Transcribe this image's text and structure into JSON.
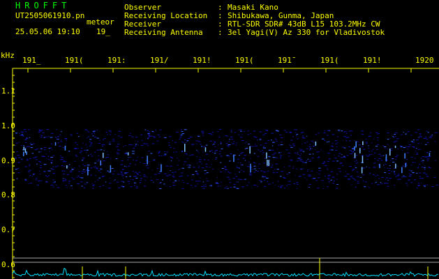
{
  "header": {
    "logo": "HROFFT",
    "filename": "UT2505061910.pn",
    "meteor_label": "meteor",
    "date_time": "25.05.06 19:10",
    "minute_label": "19_",
    "fields": [
      {
        "label": "Observer",
        "value": "Masaki Kano"
      },
      {
        "label": "Receiving Location",
        "value": "Shibukawa, Gunma, Japan"
      },
      {
        "label": "Receiver",
        "value": "RTL-SDR SDR# 43dB L15 103.2MHz CW"
      },
      {
        "label": "Receiving Antenna",
        "value": "3el Yagi(V) Az 330 for Vladivostok"
      }
    ],
    "separator": ":"
  },
  "axis": {
    "unit": "kHz",
    "x_ticks": [
      "191_",
      "191(",
      "191:",
      "191/",
      "191!",
      "191(",
      "191̄",
      "191(",
      "191!",
      "1920"
    ],
    "y_ticks": [
      "1.1",
      "1.0",
      "0.9",
      "0.8",
      "0.7",
      "0.6"
    ]
  },
  "colors": {
    "text": "#ffff00",
    "logo": "#00ff00",
    "band": "#1010a0",
    "band_bright": "#3060ff",
    "trace": "#00e0ff",
    "axis": "#ffff00"
  }
}
